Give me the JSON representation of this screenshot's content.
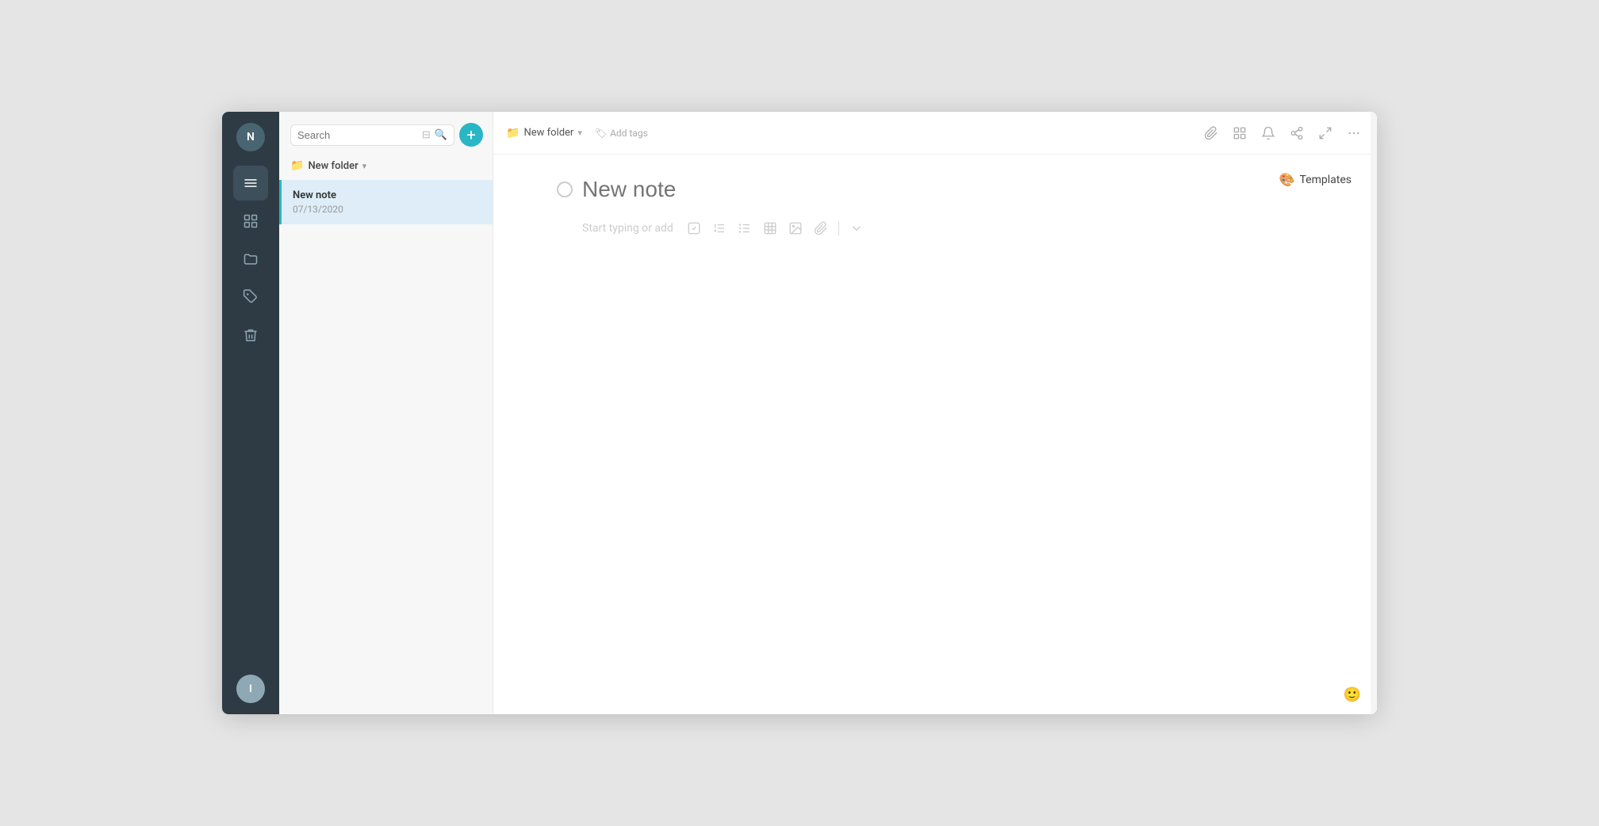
{
  "sidebar": {
    "top_avatar_label": "N",
    "bottom_avatar_label": "I",
    "nav_items": [
      {
        "id": "menu",
        "icon": "menu"
      },
      {
        "id": "apps",
        "icon": "apps"
      },
      {
        "id": "folder",
        "icon": "folder"
      },
      {
        "id": "tag",
        "icon": "tag"
      },
      {
        "id": "trash",
        "icon": "trash"
      }
    ]
  },
  "middle_panel": {
    "search_placeholder": "Search",
    "folder_name": "New folder",
    "notes": [
      {
        "title": "New note",
        "date": "07/13/2020",
        "selected": true
      }
    ]
  },
  "top_bar": {
    "folder_name": "New folder",
    "add_tags_label": "Add tags",
    "icons": [
      {
        "id": "attach",
        "label": "attach-icon"
      },
      {
        "id": "grid",
        "label": "grid-icon"
      },
      {
        "id": "bell",
        "label": "bell-icon"
      },
      {
        "id": "share",
        "label": "share-icon"
      },
      {
        "id": "expand",
        "label": "expand-icon"
      },
      {
        "id": "more",
        "label": "more-icon"
      }
    ]
  },
  "editor": {
    "note_title_placeholder": "New note",
    "body_placeholder": "Start typing or add",
    "templates_label": "Templates"
  }
}
